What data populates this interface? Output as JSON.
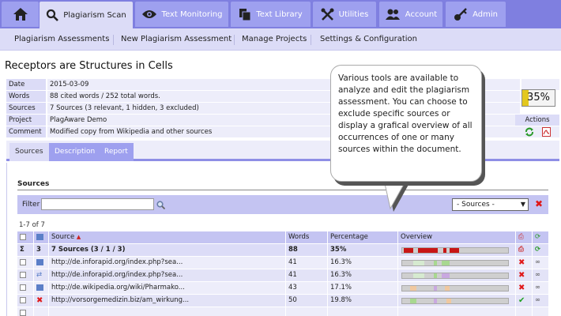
{
  "nav": {
    "tabs": [
      {
        "label": "",
        "icon": "home-icon"
      },
      {
        "label": "Plagiarism Scan",
        "icon": "magnifier-icon"
      },
      {
        "label": "Text Monitoring",
        "icon": "eye-icon"
      },
      {
        "label": "Text Library",
        "icon": "documents-icon"
      },
      {
        "label": "Utilities",
        "icon": "tools-icon"
      },
      {
        "label": "Account",
        "icon": "users-icon"
      },
      {
        "label": "Admin",
        "icon": "key-icon"
      }
    ],
    "active_tab": "Plagiarism Scan",
    "subnav": [
      "Plagiarism Assessments",
      "New Plagiarism Assessment",
      "Manage Projects",
      "Settings & Configuration"
    ]
  },
  "page": {
    "title": "Receptors are Structures in Cells"
  },
  "info": {
    "rows": [
      {
        "label": "Date",
        "value": "2015-03-09"
      },
      {
        "label": "Words",
        "value": "88 cited words / 252 total words."
      },
      {
        "label": "Sources",
        "value": "7 Sources (3 relevant, 1 hidden, 3 excluded)"
      },
      {
        "label": "Project",
        "value": "PlagAware Demo"
      },
      {
        "label": "Comment",
        "value": "Modified copy from Wikipedia and other sources"
      }
    ],
    "score": "35%",
    "score_fraction": 0.35,
    "actions_label": "Actions"
  },
  "subtabs": [
    "Sources",
    "Description",
    "Report"
  ],
  "sources": {
    "heading": "Sources",
    "filter_label": "Filter",
    "filter_value": "",
    "select_value": "- Sources -",
    "count": "1-7 of 7",
    "columns": [
      "Source",
      "Words",
      "Percentage",
      "Overview"
    ],
    "summary": {
      "sigma": "Σ",
      "count": "3",
      "source": "7 Sources (3 / 1 / 3)",
      "words": "88",
      "percentage": "35%"
    },
    "rows": [
      {
        "source": "http://de.inforapid.org/index.php?sea...",
        "words": "41",
        "percentage": "16.3%",
        "status": "excluded",
        "type": "link"
      },
      {
        "source": "http://de.inforapid.org/index.php?sea...",
        "words": "41",
        "percentage": "16.3%",
        "status": "excluded",
        "type": "duplicate"
      },
      {
        "source": "http://de.wikipedia.org/wiki/Pharmako...",
        "words": "43",
        "percentage": "17.1%",
        "status": "excluded",
        "type": "link"
      },
      {
        "source": "http://vorsorgemedizin.biz/am_wirkung...",
        "words": "50",
        "percentage": "19.8%",
        "status": "included",
        "type": "hidden"
      }
    ]
  },
  "bubble": {
    "text": "Various tools are available to analyze and edit the plagiarism assessment. You can choose to exclude specific sources or display a grafical overview of all occurrences of one or many sources within the document."
  },
  "colors": {
    "nav_bg": "#7f7fe0",
    "tab_bg": "#9ea0ef",
    "tab_active": "#dcdcf7",
    "row_light": "#ededfa",
    "highlight_red": "#c81616",
    "score_yellow": "#e3c81f"
  }
}
